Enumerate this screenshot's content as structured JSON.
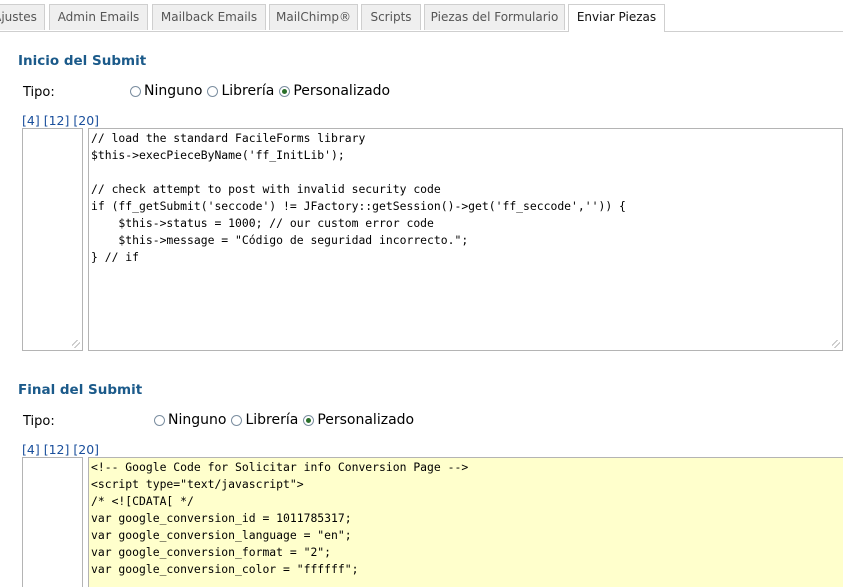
{
  "tabs": [
    {
      "label": "Ajustes"
    },
    {
      "label": "Admin Emails"
    },
    {
      "label": "Mailback Emails"
    },
    {
      "label": "MailChimp®"
    },
    {
      "label": "Scripts"
    },
    {
      "label": "Piezas del Formulario"
    },
    {
      "label": "Enviar Piezas",
      "active": true
    }
  ],
  "submit_start": {
    "title": "Inicio del Submit",
    "tipo_label": "Tipo:",
    "options": [
      "Ninguno",
      "Librería",
      "Personalizado"
    ],
    "selected": "Personalizado",
    "links": [
      "[4]",
      "[12]",
      "[20]"
    ],
    "code_lines": [
      "// load the standard FacileForms library",
      "$this->execPieceByName('ff_InitLib');",
      "",
      "// check attempt to post with invalid security code",
      "if (ff_getSubmit('seccode') != JFactory::getSession()->get('ff_seccode','')) {",
      "    $this->status = 1000; // our custom error code",
      "    $this->message = \"Código de seguridad incorrecto.\";",
      "} // if"
    ]
  },
  "submit_end": {
    "title": "Final del Submit",
    "tipo_label": "Tipo:",
    "options": [
      "Ninguno",
      "Librería",
      "Personalizado"
    ],
    "selected": "Personalizado",
    "links": [
      "[4]",
      "[12]",
      "[20]"
    ],
    "code_lines": [
      "<!-- Google Code for Solicitar info Conversion Page -->",
      "<script type=\"text/javascript\">",
      "/* <![CDATA[ */",
      "var google_conversion_id = 1011785317;",
      "var google_conversion_language = \"en\";",
      "var google_conversion_format = \"2\";",
      "var google_conversion_color = \"ffffff\";"
    ]
  }
}
